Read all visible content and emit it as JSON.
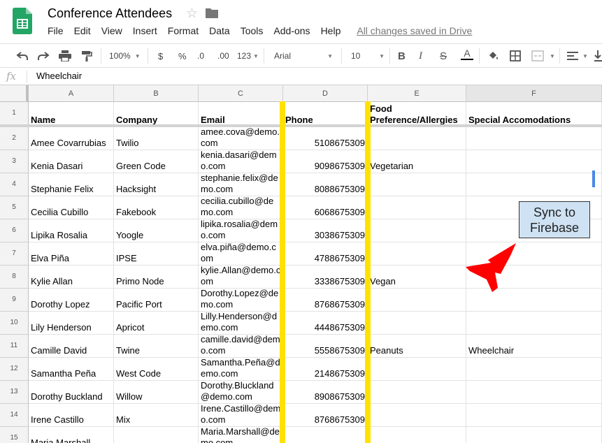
{
  "app": {
    "title": "Conference Attendees",
    "menu": [
      "File",
      "Edit",
      "View",
      "Insert",
      "Format",
      "Data",
      "Tools",
      "Add-ons",
      "Help"
    ],
    "save_status": "All changes saved in Drive"
  },
  "toolbar": {
    "zoom": "100%",
    "currency": "$",
    "percent": "%",
    "decimal_decrease": ".0",
    "decimal_increase": ".00",
    "more_formats": "123",
    "font": "Arial",
    "font_size": "10",
    "bold": "B",
    "italic": "I",
    "strikethrough": "S",
    "text_color": "A"
  },
  "formula_bar": {
    "fx": "fx",
    "value": "Wheelchair"
  },
  "grid": {
    "columns": [
      "A",
      "B",
      "C",
      "D",
      "E",
      "F"
    ],
    "header": {
      "row_number": "1",
      "name": "Name",
      "company": "Company",
      "email": "Email",
      "phone": "Phone",
      "food": "Food Preference/Allergies",
      "special": "Special Accomodations"
    },
    "rows": [
      {
        "n": "2",
        "name": "Amee Covarrubias",
        "company": "Twilio",
        "email": "amee.cova@demo.com",
        "phone": "5108675309",
        "food": "",
        "special": ""
      },
      {
        "n": "3",
        "name": "Kenia Dasari",
        "company": "Green Code",
        "email": "kenia.dasari@demo.com",
        "phone": "9098675309",
        "food": "Vegetarian",
        "special": ""
      },
      {
        "n": "4",
        "name": "Stephanie Felix",
        "company": "Hacksight",
        "email": "stephanie.felix@demo.com",
        "phone": "8088675309",
        "food": "",
        "special": ""
      },
      {
        "n": "5",
        "name": "Cecilia Cubillo",
        "company": "Fakebook",
        "email": "cecilia.cubillo@demo.com",
        "phone": "6068675309",
        "food": "",
        "special": ""
      },
      {
        "n": "6",
        "name": "Lipika Rosalia",
        "company": "Yoogle",
        "email": "lipika.rosalia@demo.com",
        "phone": "3038675309",
        "food": "",
        "special": ""
      },
      {
        "n": "7",
        "name": "Elva Piña",
        "company": "IPSE",
        "email": "elva.piña@demo.com",
        "phone": "4788675309",
        "food": "",
        "special": ""
      },
      {
        "n": "8",
        "name": "Kylie Allan",
        "company": "Primo Node",
        "email": "kylie.Allan@demo.com",
        "phone": "3338675309",
        "food": "Vegan",
        "special": ""
      },
      {
        "n": "9",
        "name": "Dorothy Lopez",
        "company": "Pacific Port",
        "email": "Dorothy.Lopez@demo.com",
        "phone": "8768675309",
        "food": "",
        "special": ""
      },
      {
        "n": "10",
        "name": "Lily Henderson",
        "company": "Apricot",
        "email": "Lilly.Henderson@demo.com",
        "phone": "4448675309",
        "food": "",
        "special": ""
      },
      {
        "n": "11",
        "name": "Camille David",
        "company": "Twine",
        "email": "camille.david@demo.com",
        "phone": "5558675309",
        "food": "Peanuts",
        "special": "Wheelchair"
      },
      {
        "n": "12",
        "name": "Samantha Peña",
        "company": "West Code",
        "email": "Samantha.Peña@demo.com",
        "phone": "2148675309",
        "food": "",
        "special": ""
      },
      {
        "n": "13",
        "name": "Dorothy Buckland",
        "company": "Willow",
        "email": "Dorothy.Bluckland@demo.com",
        "phone": "8908675309",
        "food": "",
        "special": ""
      },
      {
        "n": "14",
        "name": "Irene Castillo",
        "company": "Mix",
        "email": "Irene.Castillo@demo.com",
        "phone": "8768675309",
        "food": "",
        "special": ""
      },
      {
        "n": "15",
        "name": "Maria Marshall",
        "company": "",
        "email": "Maria.Marshall@demo.com",
        "phone": "",
        "food": "",
        "special": ""
      }
    ]
  },
  "overlay": {
    "sync_button": "Sync to Firebase",
    "highlight_color": "#ffe100",
    "arrow_color": "#ff0000"
  }
}
